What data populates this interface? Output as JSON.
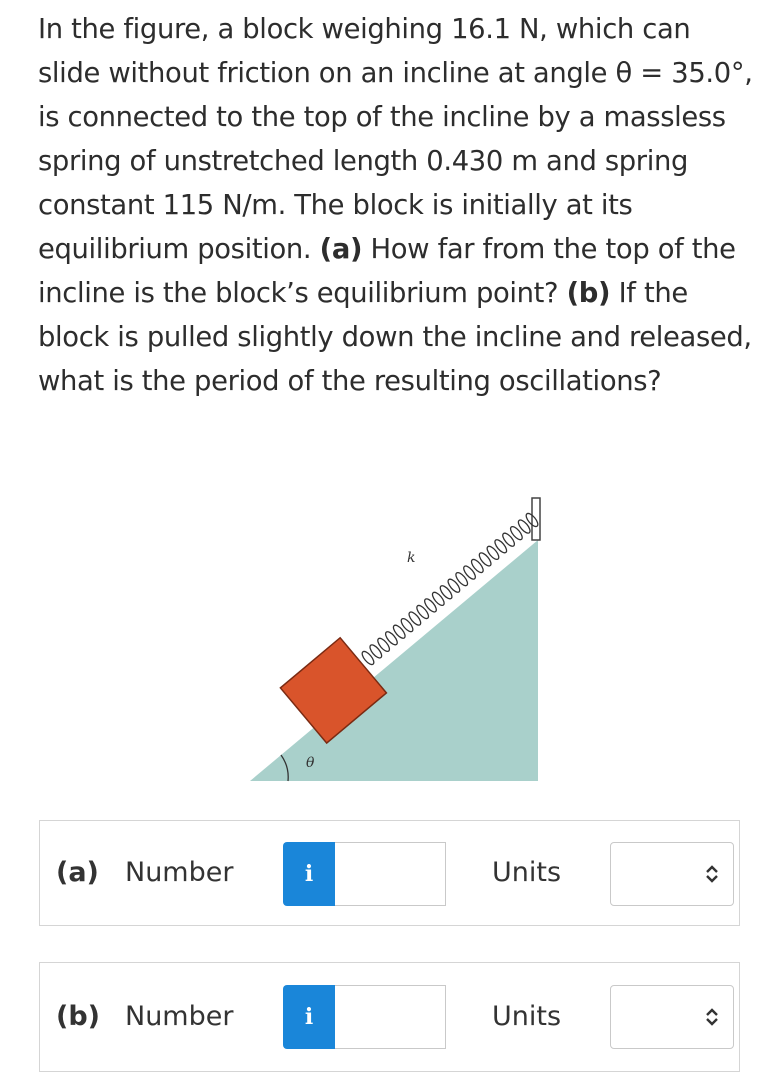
{
  "question": {
    "intro": "In the figure, a block weighing 16.1 N, which can slide without friction on an incline at angle θ = 35.0°, is connected to the top of the incline by a massless spring of unstretched length 0.430 m and spring constant 115 N/m. The block is initially at its equilibrium position.",
    "part_a_label": "(a)",
    "part_a_text": "How far from the top of the incline is the block’s equilibrium point?",
    "part_b_label": "(b)",
    "part_b_text": "If the block is pulled slightly down the incline and released, what is the period of the resulting oscillations?"
  },
  "figure": {
    "spring_label": "k",
    "angle_label": "θ",
    "colors": {
      "incline": "#a9d0cb",
      "block": "#d9542b",
      "block_edge": "#7a2a12"
    }
  },
  "answers": [
    {
      "part": "(a)",
      "number_label": "Number",
      "info_icon": "i",
      "number_value": "",
      "units_label": "Units",
      "units_value": ""
    },
    {
      "part": "(b)",
      "number_label": "Number",
      "info_icon": "i",
      "number_value": "",
      "units_label": "Units",
      "units_value": ""
    }
  ],
  "colors": {
    "info_button": "#1a86d9"
  }
}
